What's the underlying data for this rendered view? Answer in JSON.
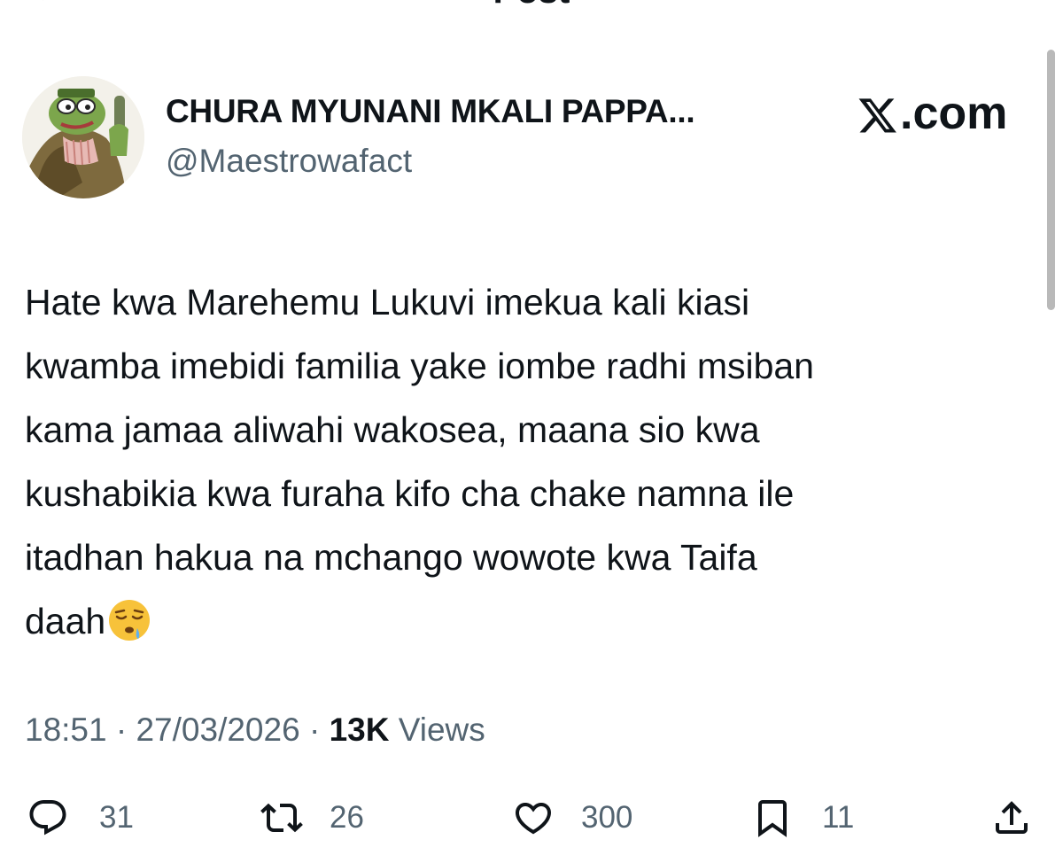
{
  "header": {
    "title": "Post",
    "back_icon": "arrow-left-icon"
  },
  "author": {
    "display_name": "CHURA MYUNANI MKALI PAPPA...",
    "handle": "@Maestrowafact",
    "avatar_icon": "frog-avatar"
  },
  "watermark": {
    "logo_icon": "x-logo-icon",
    "text": ".com"
  },
  "tweet": {
    "text": "Hate kwa Marehemu Lukuvi imekua kali kiasi\nkwamba imebidi familia yake iombe radhi msiban\nkama jamaa aliwahi wakosea, maana sio kwa\nkushabikia kwa furaha kifo cha chake namna ile\nitadhan hakua na mchango wowote kwa Taifa\ndaah",
    "emoji": "sleepy-face-emoji"
  },
  "meta": {
    "time": "18:51",
    "separator": " · ",
    "date": "27/03/2026",
    "views_count": "13K",
    "views_label": " Views"
  },
  "actions": {
    "replies": "31",
    "retweets": "26",
    "likes": "300",
    "bookmarks": "11"
  },
  "colors": {
    "text": "#0f1419",
    "secondary": "#536471",
    "background": "#ffffff"
  }
}
